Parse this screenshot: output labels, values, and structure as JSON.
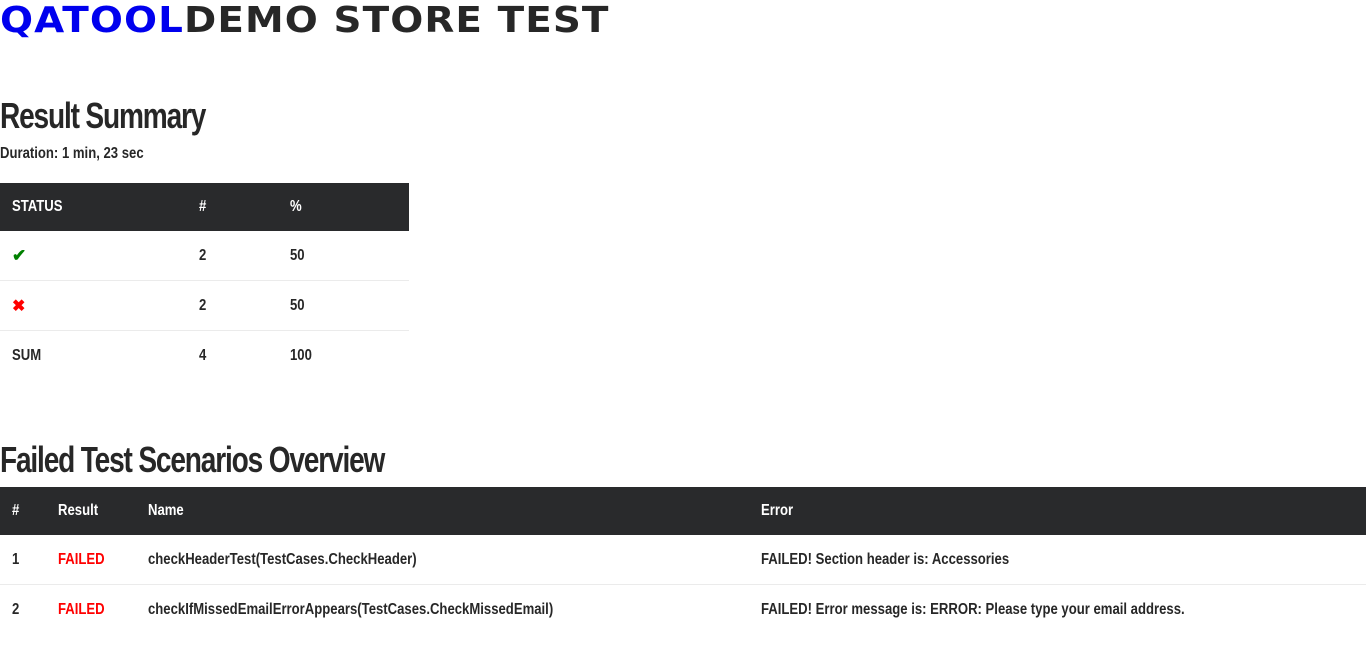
{
  "brand": {
    "part1": "QATOOL",
    "part2": "DEMO STORE TEST"
  },
  "summary": {
    "heading": "Result Summary",
    "duration": "Duration: 1 min, 23 sec",
    "columns": {
      "status": "STATUS",
      "count": "#",
      "percent": "%"
    },
    "rows": [
      {
        "status_icon": "✔",
        "status_icon_name": "check-icon",
        "count": "2",
        "percent": "50"
      },
      {
        "status_icon": "✖",
        "status_icon_name": "cross-icon",
        "count": "2",
        "percent": "50"
      },
      {
        "status": "SUM",
        "count": "4",
        "percent": "100"
      }
    ]
  },
  "failed": {
    "heading": "Failed Test Scenarios Overview",
    "columns": {
      "num": "#",
      "result": "Result",
      "name": "Name",
      "error": "Error"
    },
    "rows": [
      {
        "num": "1",
        "result": "FAILED",
        "name": "checkHeaderTest(TestCases.CheckHeader)",
        "error": "FAILED! Section header is: Accessories"
      },
      {
        "num": "2",
        "result": "FAILED",
        "name": "checkIfMissedEmailErrorAppears(TestCases.CheckMissedEmail)",
        "error": "FAILED! Error message is: ERROR: Please type your email address."
      }
    ]
  },
  "colors": {
    "brand_accent": "#0000ee",
    "header_bg": "#292a2c",
    "pass": "#008000",
    "fail": "#ff0000",
    "text": "#272727"
  }
}
